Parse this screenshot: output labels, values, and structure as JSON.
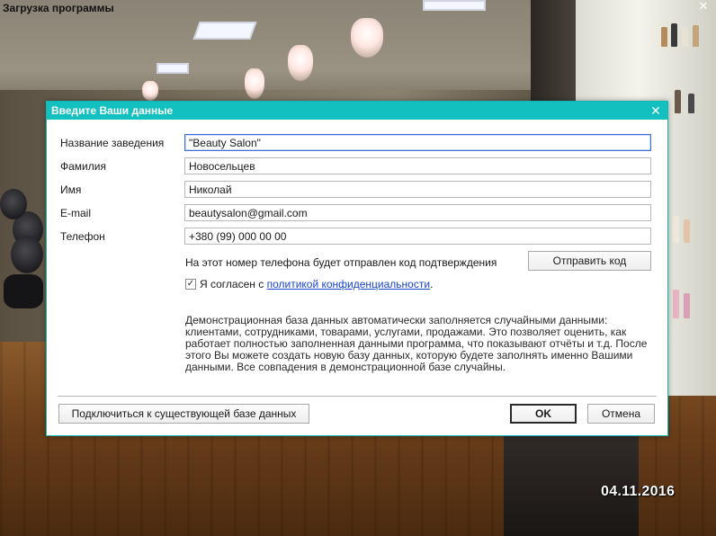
{
  "app": {
    "title": "Загрузка программы",
    "close_icon": "close-icon",
    "date_stamp": "04.11.2016"
  },
  "dialog": {
    "title": "Введите Ваши данные",
    "close_icon": "close-icon",
    "fields": [
      {
        "label": "Название заведения",
        "value": "\"Beauty Salon\"",
        "focused": true
      },
      {
        "label": "Фамилия",
        "value": "Новосельцев",
        "focused": false
      },
      {
        "label": "Имя",
        "value": "Николай",
        "focused": false
      },
      {
        "label": "E-mail",
        "value": "beautysalon@gmail.com",
        "focused": false
      },
      {
        "label": "Телефон",
        "value": "+380 (99) 000 00 00",
        "focused": false
      }
    ],
    "phone_hint": "На этот номер телефона будет отправлен код подтверждения",
    "send_code_button": "Отправить код",
    "consent": {
      "checked": true,
      "text_before": "Я согласен с ",
      "link_text": "политикой конфиденциальности",
      "text_after": "."
    },
    "info_text": "Демонстрационная база данных автоматически заполняется случайными данными: клиентами, сотрудниками, товарами, услугами, продажами. Это позволяет оценить, как работает полностью заполненная данными программа, что показывают отчёты и т.д. После этого Вы можете создать новую базу данных, которую будете заполнять именно Вашими данными. Все совпадения в демонстрационной базе случайны.",
    "connect_button": "Подключиться к существующей базе данных",
    "ok_button": "OK",
    "cancel_button": "Отмена"
  },
  "colors": {
    "dialog_header": "#12c0c0",
    "link": "#1a44c8"
  }
}
